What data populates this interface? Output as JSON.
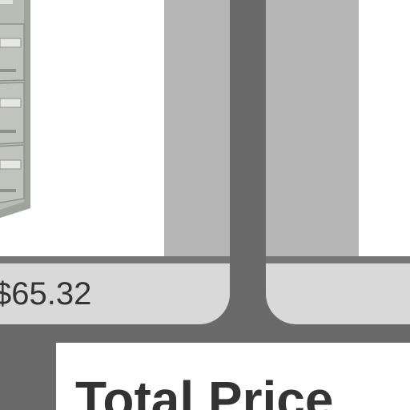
{
  "products": [
    {
      "price": "$65.32",
      "image": "filing-cabinet"
    },
    {
      "price": "",
      "image": ""
    }
  ],
  "total": {
    "label": "Total Price"
  },
  "colors": {
    "background": "#6a6a6a",
    "card": "#d9d9d9",
    "image_backdrop": "#b5b5b5",
    "divider": "#777777",
    "text": "#333333"
  }
}
